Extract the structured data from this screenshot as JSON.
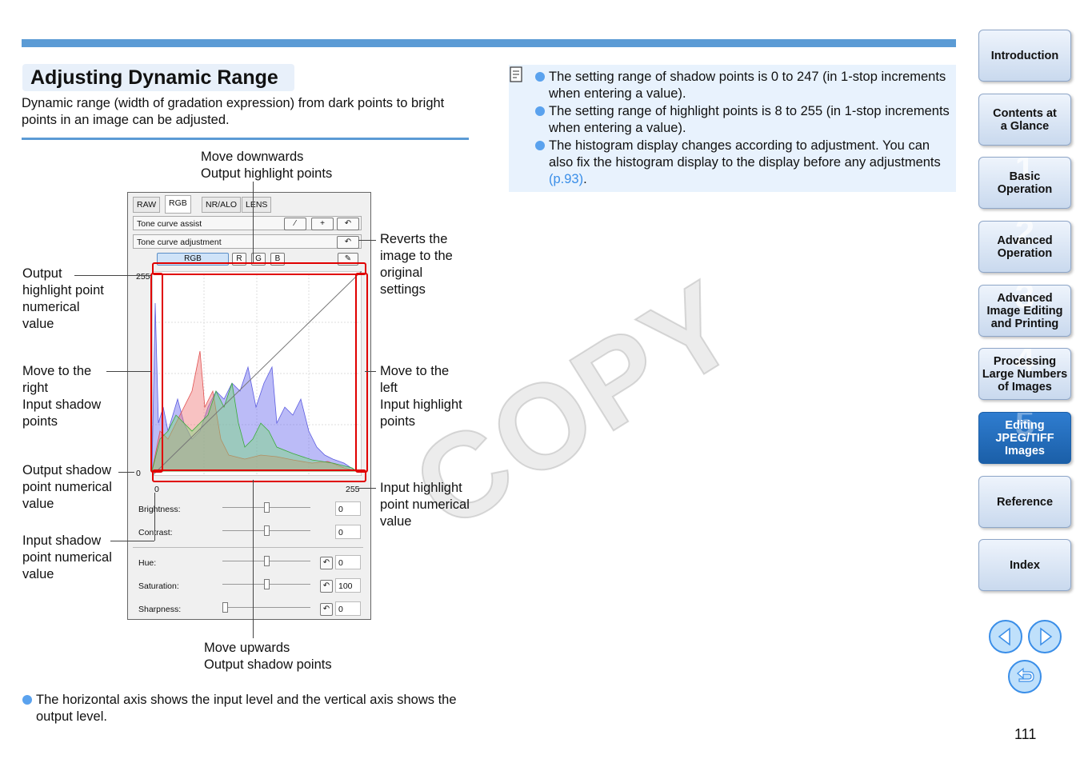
{
  "header": {
    "title": "Adjusting Dynamic Range",
    "intro": "Dynamic range (width of gradation expression) from dark points to bright points in an image can be adjusted."
  },
  "watermark": "COPY",
  "callouts": {
    "top": [
      "Move downwards",
      "Output highlight points"
    ],
    "reverts": [
      "Reverts the",
      "image to the",
      "original",
      "settings"
    ],
    "output_highlight_value": [
      "Output",
      "highlight point",
      "numerical",
      "value"
    ],
    "move_right": [
      "Move to the",
      "right",
      "Input shadow",
      "points"
    ],
    "move_left": [
      "Move to the",
      "left",
      "Input highlight",
      "points"
    ],
    "output_shadow_value": [
      "Output shadow",
      "point numerical",
      "value"
    ],
    "input_highlight_value": [
      "Input highlight",
      "point numerical",
      "value"
    ],
    "input_shadow_value": [
      "Input shadow",
      "point numerical",
      "value"
    ],
    "bottom": [
      "Move upwards",
      "Output shadow points"
    ]
  },
  "footnote": "The horizontal axis shows the input level and the vertical axis shows the output level.",
  "notes": [
    {
      "text": "The setting range of shadow points is 0 to 247 (in 1-stop increments when entering a value)."
    },
    {
      "text": "The setting range of highlight points is 8 to 255 (in 1-stop increments when entering a value)."
    },
    {
      "text": "The histogram display changes according to adjustment. You can also fix the histogram display to the display before any adjustments ",
      "link": "(p.93)",
      "after": "."
    }
  ],
  "panel": {
    "tabs": [
      "RAW",
      "RGB",
      "NR/ALO",
      "LENS"
    ],
    "tone_curve_assist": "Tone curve assist",
    "tone_curve_adjustment": "Tone curve adjustment",
    "channels": [
      "RGB",
      "R",
      "G",
      "B"
    ],
    "y_max": "255",
    "y_min": "0",
    "x_min": "0",
    "x_max": "255",
    "rows": [
      {
        "label": "Brightness:",
        "value": "0"
      },
      {
        "label": "Contrast:",
        "value": "0"
      },
      {
        "label": "Hue:",
        "value": "0"
      },
      {
        "label": "Saturation:",
        "value": "100"
      },
      {
        "label": "Sharpness:",
        "value": "0"
      }
    ]
  },
  "nav": {
    "tabs": [
      {
        "label": "Introduction",
        "num": ""
      },
      {
        "label": "Contents at a Glance",
        "num": ""
      },
      {
        "label": "Basic Operation",
        "num": "1"
      },
      {
        "label": "Advanced Operation",
        "num": "2"
      },
      {
        "label": "Advanced Image Editing and Printing",
        "num": "3"
      },
      {
        "label": "Processing Large Numbers of Images",
        "num": "4"
      },
      {
        "label": "Editing JPEG/TIFF Images",
        "num": "5"
      },
      {
        "label": "Reference",
        "num": ""
      },
      {
        "label": "Index",
        "num": ""
      }
    ],
    "page_number": "111"
  },
  "colors": {
    "accent": "#5b9bd5",
    "active_tab": "#1f68b5",
    "highlight_frame": "#e00000",
    "link": "#3a8ee8"
  }
}
